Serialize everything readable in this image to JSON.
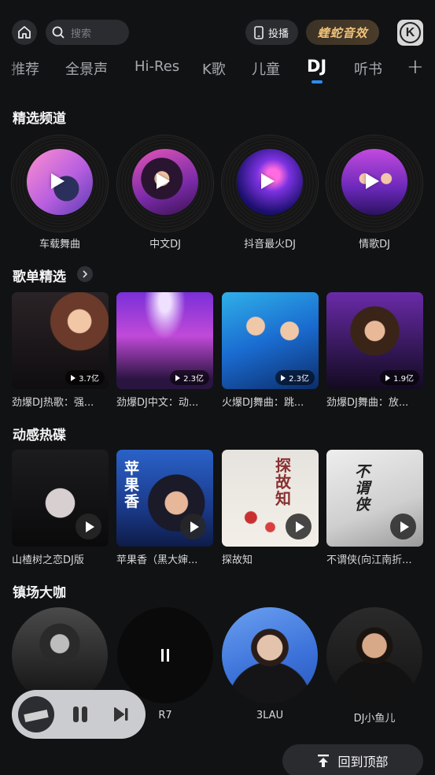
{
  "topbar": {
    "search_placeholder": "搜索",
    "cast_label": "投播",
    "effect_label": "蝰蛇音效",
    "k_label": "K"
  },
  "tabs": [
    {
      "label": "推荐"
    },
    {
      "label": "全景声"
    },
    {
      "label": "Hi-Res"
    },
    {
      "label": "K歌"
    },
    {
      "label": "儿童"
    },
    {
      "label": "DJ"
    },
    {
      "label": "听书"
    }
  ],
  "sections": {
    "channels_title": "精选频道",
    "playlists_title": "歌单精选",
    "hot_title": "动感热碟",
    "masters_title": "镇场大咖"
  },
  "channels": [
    {
      "label": "车载舞曲"
    },
    {
      "label": "中文DJ"
    },
    {
      "label": "抖音最火DJ"
    },
    {
      "label": "情歌DJ"
    }
  ],
  "playlists": [
    {
      "label": "劲爆DJ热歌：强...",
      "count": "3.7亿"
    },
    {
      "label": "劲爆DJ中文：动...",
      "count": "2.3亿"
    },
    {
      "label": "火爆DJ舞曲：跳...",
      "count": "2.3亿"
    },
    {
      "label": "劲爆DJ舞曲：放...",
      "count": "1.9亿"
    }
  ],
  "hot_discs": [
    {
      "label": "山楂树之恋DJ版",
      "cover_text": ""
    },
    {
      "label": "苹果香（黑大婶...",
      "cover_text": "苹果香"
    },
    {
      "label": "探故知",
      "cover_text": "探故知"
    },
    {
      "label": "不谓侠(向江南折...",
      "cover_text": "不谓侠"
    }
  ],
  "masters": [
    {
      "label": ""
    },
    {
      "label": "R7"
    },
    {
      "label": "3LAU"
    },
    {
      "label": "DJ小鱼儿"
    }
  ],
  "back_to_top": "回到顶部",
  "colors": {
    "accent": "#2d8cf0",
    "effect_gold": "#f1c37a",
    "background": "#111214"
  }
}
